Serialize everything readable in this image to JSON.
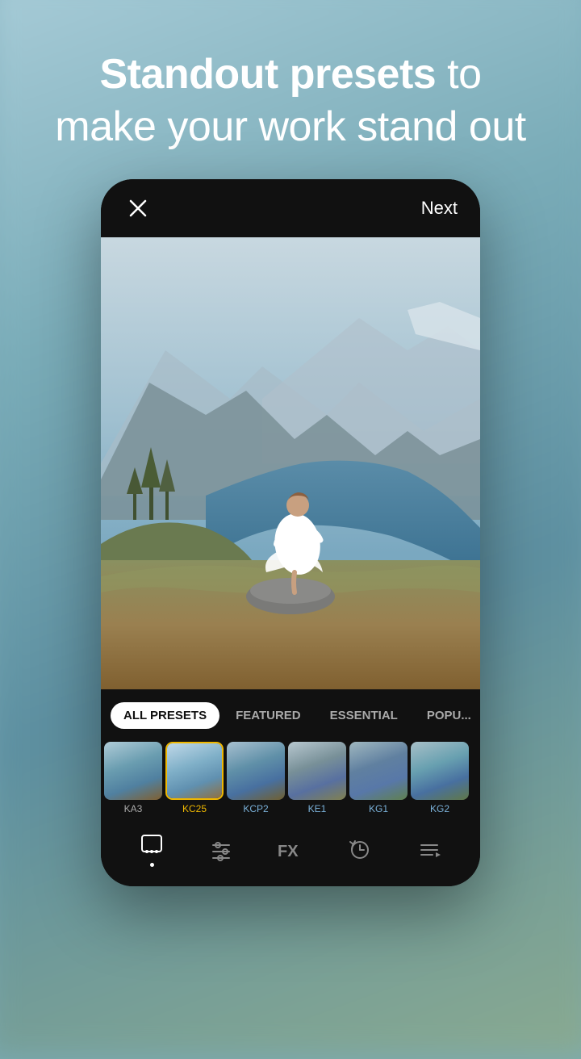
{
  "background": {
    "color": "#7aacb8"
  },
  "headline": {
    "part1": "Standout presets",
    "part2": "to",
    "line2": "make your work stand out"
  },
  "topbar": {
    "close_icon": "×",
    "next_label": "Next"
  },
  "tabs": [
    {
      "id": "all",
      "label": "ALL PRESETS",
      "active": true
    },
    {
      "id": "featured",
      "label": "FEATURED",
      "active": false
    },
    {
      "id": "essential",
      "label": "ESSENTIAL",
      "active": false
    },
    {
      "id": "popular",
      "label": "POPU...",
      "active": false
    }
  ],
  "presets": [
    {
      "id": "ka3",
      "label": "KA3",
      "selected": false,
      "variant": "ka3"
    },
    {
      "id": "kc25",
      "label": "KC25",
      "selected": true,
      "variant": "kc25"
    },
    {
      "id": "kcp2",
      "label": "KCP2",
      "selected": false,
      "variant": "kcp2"
    },
    {
      "id": "ke1",
      "label": "KE1",
      "selected": false,
      "variant": "ke1"
    },
    {
      "id": "kg1",
      "label": "KG1",
      "selected": false,
      "variant": "kg1"
    },
    {
      "id": "kg2",
      "label": "KG2",
      "selected": false,
      "variant": "kg2"
    }
  ],
  "toolbar": {
    "tools": [
      {
        "id": "presets",
        "icon": "presets-icon",
        "active": true
      },
      {
        "id": "adjust",
        "icon": "adjust-icon",
        "active": false
      },
      {
        "id": "fx",
        "icon": "fx-icon",
        "active": false
      },
      {
        "id": "history",
        "icon": "history-icon",
        "active": false
      },
      {
        "id": "menu",
        "icon": "menu-icon",
        "active": false
      }
    ]
  }
}
